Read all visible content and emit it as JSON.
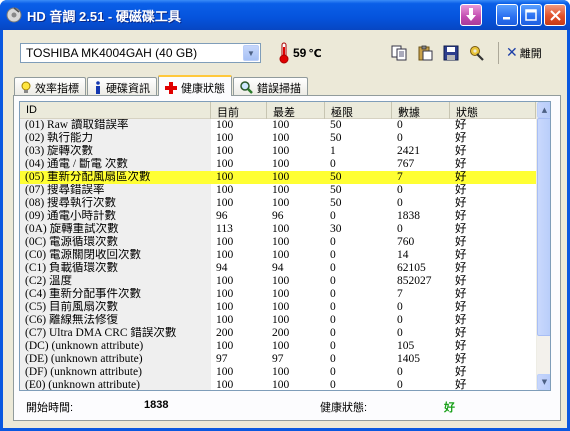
{
  "window": {
    "title": "HD 音調 2.51 - 硬磁碟工具"
  },
  "toolbar": {
    "device": "TOSHIBA MK4004GAH (40 GB)",
    "temperature": "59",
    "temperature_unit": "℃",
    "exit_label": "離開"
  },
  "tabs": [
    {
      "label": "效率指標",
      "icon": "lightbulb-icon"
    },
    {
      "label": "硬碟資訊",
      "icon": "info-icon"
    },
    {
      "label": "健康狀態",
      "icon": "red-cross-icon"
    },
    {
      "label": "錯誤掃描",
      "icon": "magnifier-icon"
    }
  ],
  "table": {
    "headers": [
      "ID",
      "目前",
      "最差",
      "極限",
      "數據",
      "狀態"
    ],
    "highlight_row": 4,
    "rows": [
      [
        "(01) Raw 讀取錯誤率",
        "100",
        "100",
        "50",
        "0",
        "好"
      ],
      [
        "(02) 執行能力",
        "100",
        "100",
        "50",
        "0",
        "好"
      ],
      [
        "(03) 旋轉次數",
        "100",
        "100",
        "1",
        "2421",
        "好"
      ],
      [
        "(04) 通電 / 斷電 次數",
        "100",
        "100",
        "0",
        "767",
        "好"
      ],
      [
        "(05) 重新分配風扇區次數",
        "100",
        "100",
        "50",
        "7",
        "好"
      ],
      [
        "(07) 搜尋錯誤率",
        "100",
        "100",
        "50",
        "0",
        "好"
      ],
      [
        "(08) 搜尋執行次數",
        "100",
        "100",
        "50",
        "0",
        "好"
      ],
      [
        "(09) 通電小時計數",
        "96",
        "96",
        "0",
        "1838",
        "好"
      ],
      [
        "(0A) 旋轉重試次數",
        "113",
        "100",
        "30",
        "0",
        "好"
      ],
      [
        "(0C) 電源循環次數",
        "100",
        "100",
        "0",
        "760",
        "好"
      ],
      [
        "(C0) 電源關閉收回次數",
        "100",
        "100",
        "0",
        "14",
        "好"
      ],
      [
        "(C1) 負載循環次數",
        "94",
        "94",
        "0",
        "62105",
        "好"
      ],
      [
        "(C2) 溫度",
        "100",
        "100",
        "0",
        "852027",
        "好"
      ],
      [
        "(C4) 重新分配事件次數",
        "100",
        "100",
        "0",
        "7",
        "好"
      ],
      [
        "(C5) 目前風扇次數",
        "100",
        "100",
        "0",
        "0",
        "好"
      ],
      [
        "(C6) 離線無法修復",
        "100",
        "100",
        "0",
        "0",
        "好"
      ],
      [
        "(C7) Ultra DMA CRC 錯誤次數",
        "200",
        "200",
        "0",
        "0",
        "好"
      ],
      [
        "(DC) (unknown attribute)",
        "100",
        "100",
        "0",
        "105",
        "好"
      ],
      [
        "(DE) (unknown attribute)",
        "97",
        "97",
        "0",
        "1405",
        "好"
      ],
      [
        "(DF) (unknown attribute)",
        "100",
        "100",
        "0",
        "0",
        "好"
      ],
      [
        "(E0) (unknown attribute)",
        "100",
        "100",
        "0",
        "0",
        "好"
      ]
    ]
  },
  "status_bar": {
    "start_time_label": "開始時間:",
    "start_time_value": "1838",
    "health_label": "健康狀態:",
    "health_value": "好"
  },
  "colors": {
    "highlight": "#ffff33",
    "health_good": "#19a019",
    "title_bar": "#0553dc"
  }
}
